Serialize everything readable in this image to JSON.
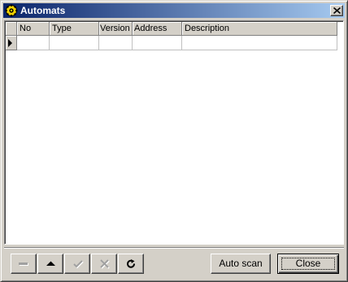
{
  "window": {
    "title": "Automats",
    "close_label": "×",
    "colors": {
      "titlebar_start": "#0a246a",
      "titlebar_end": "#a6caf0",
      "face": "#d4d0c8"
    }
  },
  "grid": {
    "columns": [
      "No",
      "Type",
      "Version",
      "Address",
      "Description"
    ],
    "rows": [
      [
        "",
        "",
        "",
        "",
        ""
      ]
    ]
  },
  "toolbar": {
    "buttons": [
      {
        "icon": "minus-icon",
        "enabled": false
      },
      {
        "icon": "arrow-up-icon",
        "enabled": true
      },
      {
        "icon": "checkmark-icon",
        "enabled": false
      },
      {
        "icon": "cancel-x-icon",
        "enabled": false
      },
      {
        "icon": "refresh-icon",
        "enabled": true
      }
    ]
  },
  "actions": {
    "auto_scan_label": "Auto scan",
    "close_label": "Close"
  }
}
